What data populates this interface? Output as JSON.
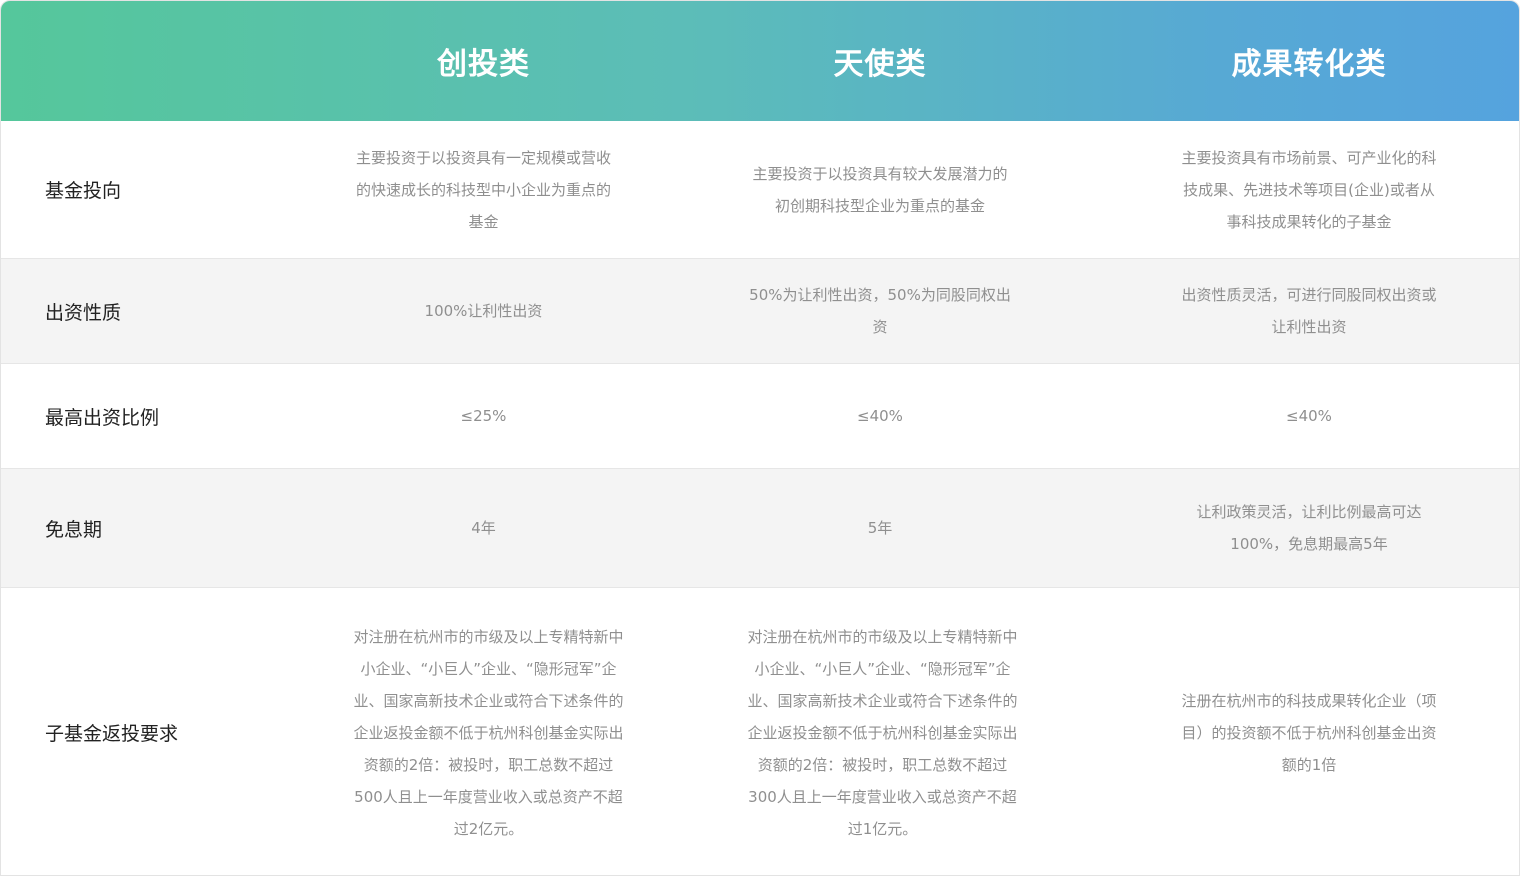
{
  "header": {
    "columns": [
      "创投类",
      "天使类",
      "成果转化类"
    ]
  },
  "rows": [
    {
      "label": "基金投向",
      "values": [
        "主要投资于以投资具有一定规模或营收的快速成长的科技型中小企业为重点的基金",
        "主要投资于以投资具有较大发展潜力的初创期科技型企业为重点的基金",
        "主要投资具有市场前景、可产业化的科技成果、先进技术等项目(企业)或者从事科技成果转化的子基金"
      ]
    },
    {
      "label": "出资性质",
      "values": [
        "100%让利性出资",
        "50%为让利性出资，50%为同股同权出资",
        "出资性质灵活，可进行同股同权出资或让利性出资"
      ]
    },
    {
      "label": "最高出资比例",
      "values": [
        "≤25%",
        "≤40%",
        "≤40%"
      ]
    },
    {
      "label": "免息期",
      "values": [
        "4年",
        "5年",
        "让利政策灵活，让利比例最高可达100%，免息期最高5年"
      ]
    },
    {
      "label": "子基金返投要求",
      "values": [
        "对注册在杭州市的市级及以上专精特新中小企业、“小巨人”企业、“隐形冠军”企业、国家高新技术企业或符合下述条件的企业返投金额不低于杭州科创基金实际出资额的2倍：被投时，职工总数不超过500人且上一年度营业收入或总资产不超过2亿元。",
        "对注册在杭州市的市级及以上专精特新中小企业、“小巨人”企业、“隐形冠军”企业、国家高新技术企业或符合下述条件的企业返投金额不低于杭州科创基金实际出资额的2倍：被投时，职工总数不超过300人且上一年度营业收入或总资产不超过1亿元。",
        "注册在杭州市的科技成果转化企业（项目）的投资额不低于杭州科创基金出资额的1倍"
      ]
    }
  ],
  "colors": {
    "header_gradient_start": "#55c79b",
    "header_gradient_end": "#55a3de",
    "row_shade": "#f4f4f4",
    "label_text": "#222222",
    "cell_text": "#8f8f8f"
  }
}
